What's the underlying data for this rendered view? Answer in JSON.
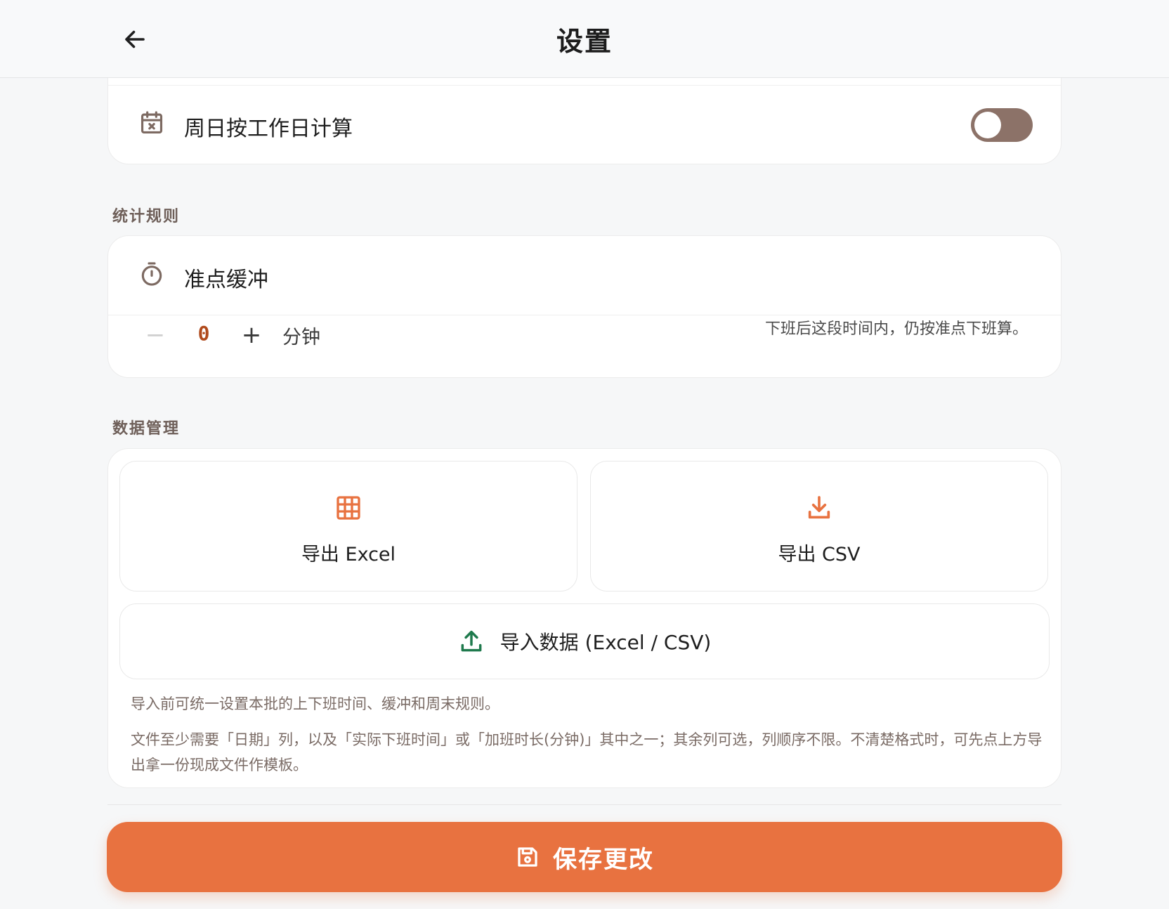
{
  "header": {
    "title": "设置",
    "back_icon": "arrow-left-icon"
  },
  "weekend_card": {
    "icon": "calendar-x-icon",
    "label": "周日按工作日计算",
    "toggle_on": false,
    "toggle_color": "#8c7268"
  },
  "sections": {
    "stats_rules": "统计规则",
    "data_management": "数据管理"
  },
  "buffer_card": {
    "icon": "stopwatch-icon",
    "label": "准点缓冲",
    "decrement_label": "−",
    "value": "0",
    "increment_label": "+",
    "unit": "分钟",
    "hint": "下班后这段时间内，仍按准点下班算。"
  },
  "data_card": {
    "export_excel": {
      "icon": "grid-table-icon",
      "label": "导出 Excel"
    },
    "export_csv": {
      "icon": "download-icon",
      "label": "导出 CSV"
    },
    "import": {
      "icon": "upload-icon",
      "label": "导入数据 (Excel / CSV)"
    },
    "note_1": "导入前可统一设置本批的上下班时间、缓冲和周末规则。",
    "note_2": "文件至少需要「日期」列，以及「实际下班时间」或「加班时长(分钟)」其中之一；其余列可选，列顺序不限。不清楚格式时，可先点上方导出拿一份现成文件作模板。"
  },
  "save_button": {
    "icon": "save-icon",
    "label": "保存更改"
  },
  "colors": {
    "accent": "#e87240",
    "icon_brown": "#7d6a62",
    "import_green": "#1f7a4d",
    "value_text": "#b04a1c"
  }
}
